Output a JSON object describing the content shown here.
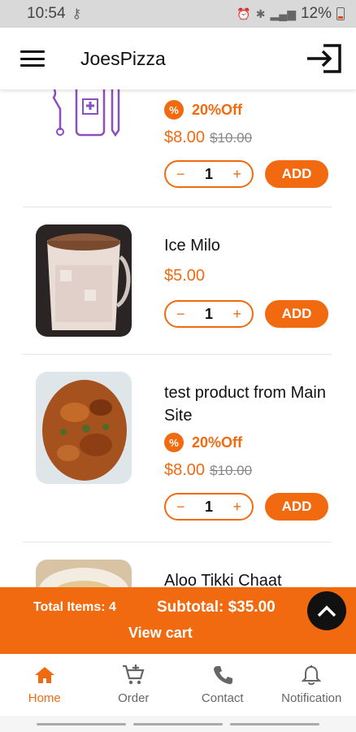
{
  "status": {
    "time": "10:54",
    "battery": "12%"
  },
  "header": {
    "title": "JoesPizza"
  },
  "products": [
    {
      "name": "",
      "discount": "20%Off",
      "badge": "%",
      "price": "$8.00",
      "old_price": "$10.00",
      "qty": "1",
      "add": "ADD",
      "image": "medicine-icon"
    },
    {
      "name": "Ice Milo",
      "price": "$5.00",
      "qty": "1",
      "add": "ADD",
      "image": "iced-drink-photo"
    },
    {
      "name_line1": "test product from Main",
      "name_line2": "Site",
      "discount": "20%Off",
      "badge": "%",
      "price": "$8.00",
      "old_price": "$10.00",
      "qty": "1",
      "add": "ADD",
      "image": "fried-food-photo"
    },
    {
      "name": "Aloo Tikki Chaat",
      "image": "chaat-photo"
    }
  ],
  "stepper": {
    "minus": "−",
    "plus": "+"
  },
  "cart": {
    "total_items": "Total Items: 4",
    "subtotal": "Subtotal: $35.00",
    "view_cart": "View cart"
  },
  "nav": {
    "items": [
      {
        "label": "Home",
        "icon": "home-icon",
        "active": true
      },
      {
        "label": "Order",
        "icon": "cart-add-icon",
        "active": false
      },
      {
        "label": "Contact",
        "icon": "phone-icon",
        "active": false
      },
      {
        "label": "Notification",
        "icon": "bell-icon",
        "active": false
      }
    ]
  },
  "colors": {
    "accent": "#f26a10",
    "dark": "#111111"
  }
}
